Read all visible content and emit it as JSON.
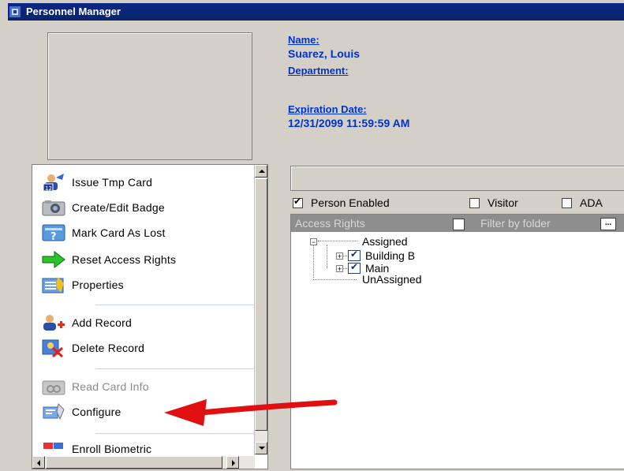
{
  "window": {
    "title": "Personnel Manager"
  },
  "person": {
    "name_label": "Name:",
    "name_value": "Suarez, Louis",
    "department_label": "Department:",
    "expiration_label": "Expiration Date:",
    "expiration_value": "12/31/2099 11:59:59 AM"
  },
  "sidebar": {
    "items": [
      {
        "label": "Issue Tmp Card",
        "icon": "issue-card-icon",
        "enabled": true
      },
      {
        "label": "Create/Edit Badge",
        "icon": "camera-icon",
        "enabled": true
      },
      {
        "label": "Mark Card As Lost",
        "icon": "lost-card-icon",
        "enabled": true
      },
      {
        "label": "Reset Access Rights",
        "icon": "green-arrow-icon",
        "enabled": true
      },
      {
        "label": "Properties",
        "icon": "properties-icon",
        "enabled": true
      },
      {
        "label": "Add Record",
        "icon": "add-user-icon",
        "enabled": true
      },
      {
        "label": "Delete Record",
        "icon": "delete-record-icon",
        "enabled": true
      },
      {
        "label": "Read Card Info",
        "icon": "card-reader-icon",
        "enabled": false
      },
      {
        "label": "Configure",
        "icon": "configure-icon",
        "enabled": true
      },
      {
        "label": "Enroll Biometric",
        "icon": "biometric-icon",
        "enabled": true
      }
    ]
  },
  "flags": {
    "person_enabled": {
      "label": "Person Enabled",
      "checked": true
    },
    "visitor": {
      "label": "Visitor",
      "checked": false
    },
    "ada": {
      "label": "ADA",
      "checked": false
    }
  },
  "access_rights": {
    "header": "Access Rights",
    "filter_label": "Filter by folder",
    "browse_label": "...",
    "assigned_label": "Assigned",
    "assigned_items": [
      {
        "label": "Building B",
        "checked": true
      },
      {
        "label": "Main",
        "checked": true
      }
    ],
    "unassigned_label": "UnAssigned"
  },
  "colors": {
    "title_bar": "#0a246a",
    "info_text": "#0033cc",
    "annotation_arrow": "#e01010"
  }
}
